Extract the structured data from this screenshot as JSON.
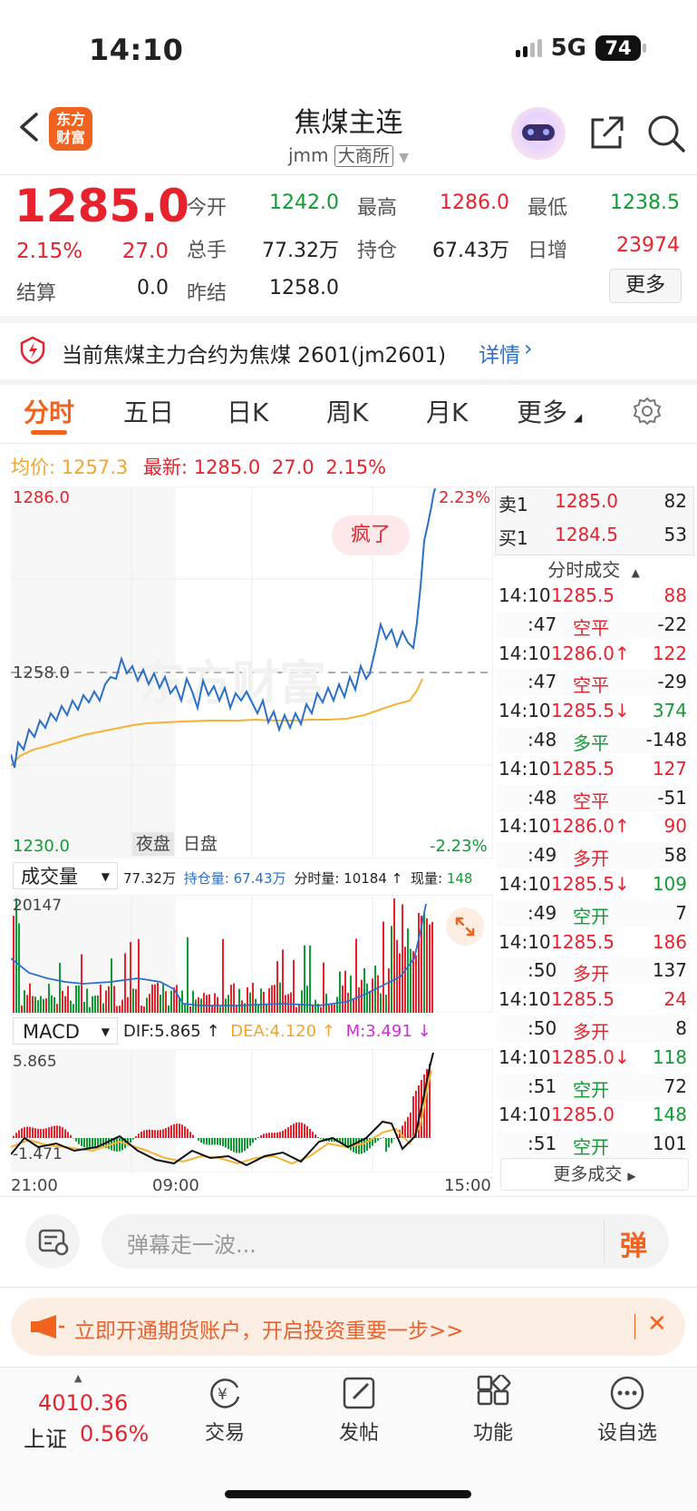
{
  "status_bar": {
    "time": "14:10",
    "network": "5G",
    "battery": "74"
  },
  "header": {
    "logo_line1": "东方",
    "logo_line2": "财富",
    "title": "焦煤主连",
    "subtitle": "jmm",
    "exchange": "大商所"
  },
  "quote": {
    "price": "1285.0",
    "change_pct": "2.15%",
    "change": "27.0",
    "settle_label": "结算",
    "settle": "0.0",
    "open_label": "今开",
    "open": "1242.0",
    "high_label": "最高",
    "high": "1286.0",
    "low_label": "最低",
    "low": "1238.5",
    "volume_label": "总手",
    "volume": "77.32万",
    "oi_label": "持仓",
    "oi": "67.43万",
    "daily_inc_label": "日增",
    "daily_inc": "23974",
    "prev_settle_label": "昨结",
    "prev_settle": "1258.0",
    "more_label": "更多"
  },
  "notice": {
    "text": "当前焦煤主力合约为焦煤 2601(jm2601)",
    "link": "详情"
  },
  "tabs": [
    "分时",
    "五日",
    "日K",
    "周K",
    "月K",
    "更多"
  ],
  "info_line": {
    "avg_label": "均价:",
    "avg": "1257.3",
    "latest_label": "最新:",
    "latest": "1285.0",
    "change": "27.0",
    "change_pct": "2.15%"
  },
  "chart_labels": {
    "y_top": "1286.0",
    "y_mid": "1258.0",
    "y_bottom": "1230.0",
    "pct_top": "2.23%",
    "pct_bottom": "-2.23%",
    "bubble": "疯了",
    "night_tab": "夜盘",
    "day_tab": "日盘",
    "watermark": "东方财富"
  },
  "volume_bar": {
    "selector": "成交量",
    "total": "77.32万",
    "oi_label": "持仓量:",
    "oi": "67.43万",
    "tick_label": "分时量:",
    "tick": "10184 ↑",
    "now_label": "现量:",
    "now": "148",
    "max": "20147"
  },
  "macd_bar": {
    "selector": "MACD",
    "dif": "DIF:5.865 ↑",
    "dea": "DEA:4.120 ↑",
    "m": "M:3.491 ↓",
    "top": "5.865",
    "bottom": "-1.471"
  },
  "time_axis": [
    "21:00",
    "09:00",
    "15:00"
  ],
  "order_book": {
    "sell_label": "卖1",
    "sell_price": "1285.0",
    "sell_vol": "82",
    "buy_label": "买1",
    "buy_price": "1284.5",
    "buy_vol": "53"
  },
  "trades_title": "分时成交",
  "trades": [
    {
      "t": "14:10",
      "v1": "1285.5",
      "v2": "88",
      "c1": "red",
      "c2": "red"
    },
    {
      "t": ":47",
      "v1": "空平",
      "v2": "-22",
      "c1": "red",
      "c2": "black"
    },
    {
      "t": "14:10",
      "v1": "1286.0↑",
      "v2": "122",
      "c1": "red",
      "c2": "red"
    },
    {
      "t": ":47",
      "v1": "空平",
      "v2": "-29",
      "c1": "red",
      "c2": "black"
    },
    {
      "t": "14:10",
      "v1": "1285.5↓",
      "v2": "374",
      "c1": "red",
      "c2": "green"
    },
    {
      "t": ":48",
      "v1": "多平",
      "v2": "-148",
      "c1": "green",
      "c2": "black"
    },
    {
      "t": "14:10",
      "v1": "1285.5",
      "v2": "127",
      "c1": "red",
      "c2": "red"
    },
    {
      "t": ":48",
      "v1": "空平",
      "v2": "-51",
      "c1": "red",
      "c2": "black"
    },
    {
      "t": "14:10",
      "v1": "1286.0↑",
      "v2": "90",
      "c1": "red",
      "c2": "red"
    },
    {
      "t": ":49",
      "v1": "多开",
      "v2": "58",
      "c1": "red",
      "c2": "black"
    },
    {
      "t": "14:10",
      "v1": "1285.5↓",
      "v2": "109",
      "c1": "red",
      "c2": "green"
    },
    {
      "t": ":49",
      "v1": "空开",
      "v2": "7",
      "c1": "green",
      "c2": "black"
    },
    {
      "t": "14:10",
      "v1": "1285.5",
      "v2": "186",
      "c1": "red",
      "c2": "red"
    },
    {
      "t": ":50",
      "v1": "多开",
      "v2": "137",
      "c1": "red",
      "c2": "black"
    },
    {
      "t": "14:10",
      "v1": "1285.5",
      "v2": "24",
      "c1": "red",
      "c2": "red"
    },
    {
      "t": ":50",
      "v1": "多开",
      "v2": "8",
      "c1": "red",
      "c2": "black"
    },
    {
      "t": "14:10",
      "v1": "1285.0↓",
      "v2": "118",
      "c1": "red",
      "c2": "green"
    },
    {
      "t": ":51",
      "v1": "空开",
      "v2": "72",
      "c1": "green",
      "c2": "black"
    },
    {
      "t": "14:10",
      "v1": "1285.0",
      "v2": "148",
      "c1": "red",
      "c2": "green"
    },
    {
      "t": ":51",
      "v1": "空开",
      "v2": "101",
      "c1": "green",
      "c2": "black"
    }
  ],
  "more_trades": "更多成交",
  "comment": {
    "placeholder": "弹幕走一波...",
    "send": "弹"
  },
  "promo": {
    "text": "立即开通期货账户，开启投资重要一步>>"
  },
  "bottom_nav": {
    "index_value": "4010.36",
    "index_name": "上证",
    "index_pct": "0.56%",
    "tabs": [
      "交易",
      "发帖",
      "功能",
      "设自选"
    ]
  },
  "colors": {
    "up": "#e8222d",
    "down": "#119b35",
    "accent": "#f26a1b",
    "price_line": "#2a6fc9",
    "avg_line": "#f5b335"
  }
}
